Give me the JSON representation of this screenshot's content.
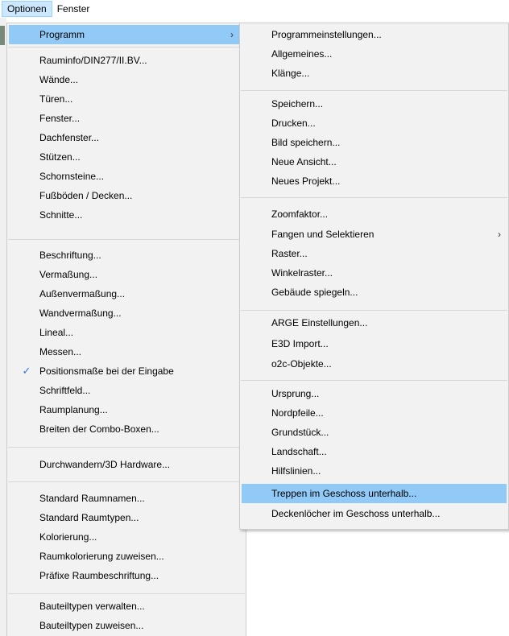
{
  "menubar": {
    "items": [
      "Optionen",
      "Fenster"
    ]
  },
  "main_menu": {
    "items": [
      "Programm",
      "Rauminfo/DIN277/II.BV...",
      "Wände...",
      "Türen...",
      "Fenster...",
      "Dachfenster...",
      "Stützen...",
      "Schornsteine...",
      "Fußböden / Decken...",
      "Schnitte...",
      "Beschriftung...",
      "Vermaßung...",
      "Außenvermaßung...",
      "Wandvermaßung...",
      "Lineal...",
      "Messen...",
      "Positionsmaße bei der Eingabe",
      "Schriftfeld...",
      "Raumplanung...",
      "Breiten der Combo-Boxen...",
      "Durchwandern/3D Hardware...",
      "Standard Raumnamen...",
      "Standard Raumtypen...",
      "Kolorierung...",
      "Raumkolorierung zuweisen...",
      "Präfixe Raumbeschriftung...",
      "Bauteiltypen verwalten...",
      "Bauteiltypen zuweisen..."
    ],
    "checked_item": "Positionsmaße bei der Eingabe"
  },
  "sub_menu": {
    "items": [
      "Programmeinstellungen...",
      "Allgemeines...",
      "Klänge...",
      "Speichern...",
      "Drucken...",
      "Bild speichern...",
      "Neue Ansicht...",
      "Neues Projekt...",
      "Zoomfaktor...",
      "Fangen und Selektieren",
      "Raster...",
      "Winkelraster...",
      "Gebäude spiegeln...",
      "ARGE Einstellungen...",
      "E3D Import...",
      "o2c-Objekte...",
      "Ursprung...",
      "Nordpfeile...",
      "Grundstück...",
      "Landschaft...",
      "Hilfslinien...",
      "Treppen im Geschoss unterhalb...",
      "Deckenlöcher im Geschoss unterhalb..."
    ],
    "highlighted_item": "Treppen im Geschoss unterhalb..."
  },
  "glyphs": {
    "submenu_arrow": "›",
    "check": "✓"
  },
  "colors": {
    "menu_bg": "#f2f2f2",
    "highlight": "#91c9f7",
    "menubar_active": "#cce8ff",
    "check": "#2e7bd8"
  }
}
